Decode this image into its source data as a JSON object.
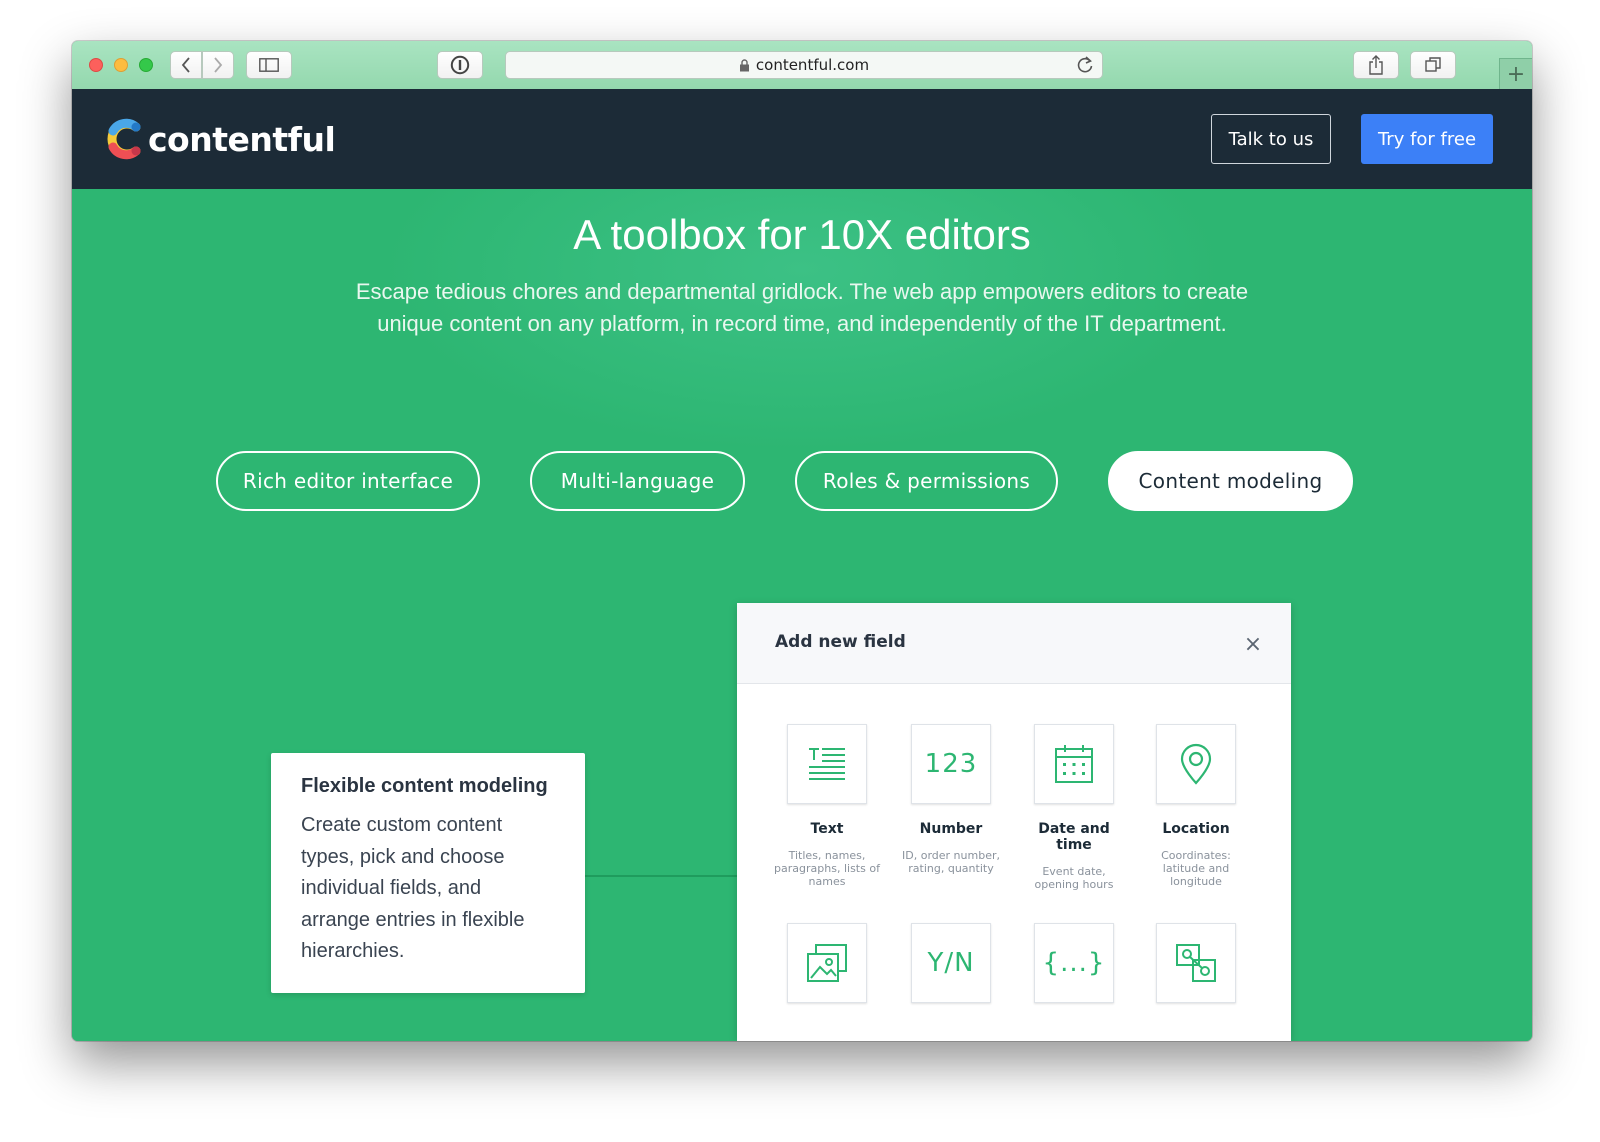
{
  "browser": {
    "url": "contentful.com",
    "new_tab_symbol": "+"
  },
  "navbar": {
    "logo_text": "contentful",
    "talk_label": "Talk to us",
    "try_label": "Try for free"
  },
  "hero": {
    "title": "A toolbox for 10X editors",
    "subtitle": "Escape tedious chores and departmental gridlock. The web app empowers editors to create unique content on any platform, in record time, and independently of the IT department."
  },
  "tabs": [
    {
      "label": "Rich editor interface",
      "active": false
    },
    {
      "label": "Multi-language",
      "active": false
    },
    {
      "label": "Roles & permissions",
      "active": false
    },
    {
      "label": "Content modeling",
      "active": true
    }
  ],
  "feature": {
    "title": "Flexible content modeling",
    "text": "Create custom content types, pick and choose individual fields, and arrange entries in flexible hierarchies."
  },
  "panel": {
    "title": "Add new field",
    "close_symbol": "×",
    "fields": [
      {
        "name": "Text",
        "desc": "Titles, names, paragraphs, lists of names",
        "icon": "text-lines-icon"
      },
      {
        "name": "Number",
        "desc": "ID, order number, rating, quantity",
        "icon": "number-icon",
        "glyph": "123"
      },
      {
        "name": "Date and time",
        "desc": "Event date, opening hours",
        "icon": "calendar-icon"
      },
      {
        "name": "Location",
        "desc": "Coordinates: latitude and longitude",
        "icon": "location-pin-icon"
      },
      {
        "icon": "media-icon"
      },
      {
        "icon": "boolean-icon",
        "glyph": "Y/N"
      },
      {
        "icon": "json-object-icon",
        "glyph": "{...}"
      },
      {
        "icon": "reference-icon"
      }
    ]
  },
  "colors": {
    "hero_green": "#2db672",
    "navbar": "#1c2b37",
    "cta_blue": "#3c80f7"
  }
}
